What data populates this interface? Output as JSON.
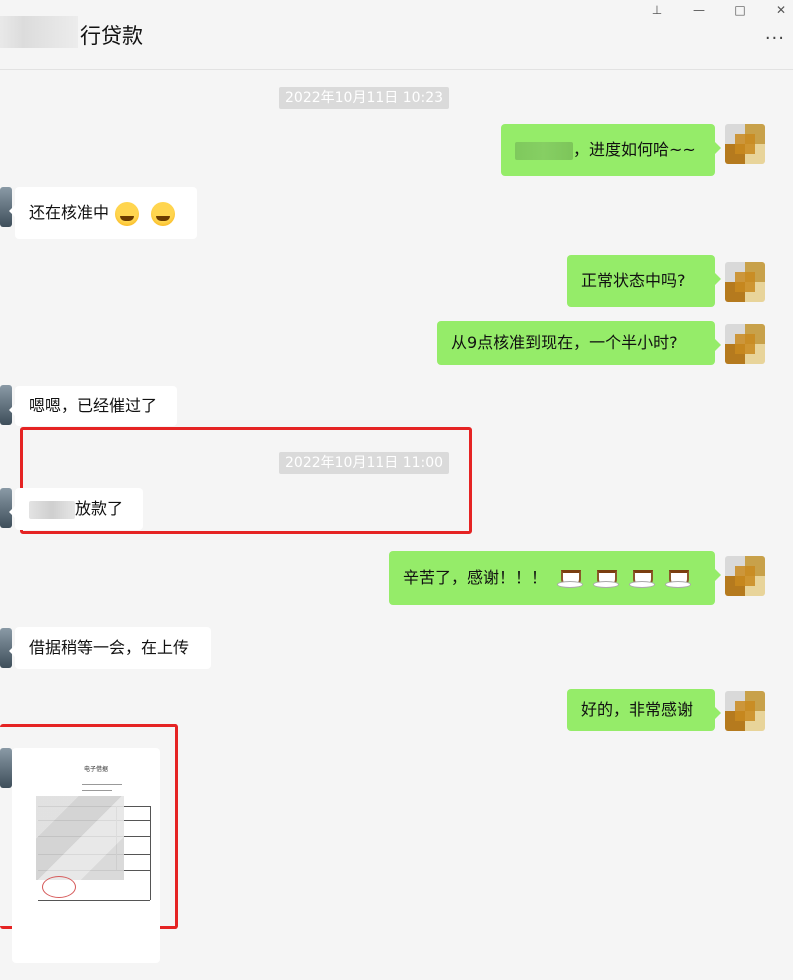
{
  "header": {
    "title": "行贷款"
  },
  "window_controls": {
    "pin": "⊥",
    "minimize": "—",
    "maximize": "□",
    "close": "✕"
  },
  "more_label": "···",
  "messages": {
    "ts1": "2022年10月11日 10:23",
    "m1_text": "，进度如何哈~~",
    "m2_text": "还在核准中",
    "m3_text": "正常状态中吗?",
    "m4_text": "从9点核准到现在，一个半小时?",
    "m5_text": "嗯嗯，已经催过了",
    "ts2": "2022年10月11日 11:00",
    "m6_text": "放款了",
    "m7_text": "辛苦了，感谢！！！",
    "m8_text": "借据稍等一会，在上传",
    "m9_text": "好的，非常感谢"
  },
  "document_preview": {
    "title": "电子借据"
  },
  "colors": {
    "self_bubble": "#95ec69",
    "other_bubble": "#ffffff",
    "highlight_box": "#e52323",
    "background": "#f5f5f5"
  },
  "icons": {
    "laugh_emoji": "laughing-crying-emoji",
    "coffee_emoji": "hot-beverage-emoji"
  }
}
